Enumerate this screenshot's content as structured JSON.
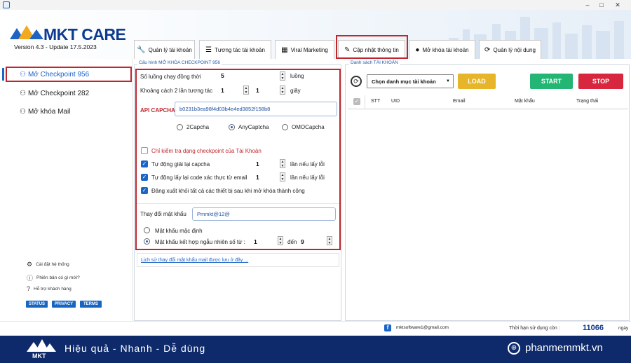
{
  "window": {
    "minimize": "‒",
    "maximize": "□",
    "close": "✕"
  },
  "header": {
    "brand": "MKT CARE",
    "version": "Version 4.3 - Update 17.5.2023"
  },
  "tabs": [
    {
      "label": "Quản lý tài khoản",
      "icon": "wrench-icon"
    },
    {
      "label": "Tương tác tài khoản",
      "icon": "list-icon"
    },
    {
      "label": "Viral Marketing",
      "icon": "calendar-icon"
    },
    {
      "label": "Cập nhật thông tin",
      "icon": "pencil-icon"
    },
    {
      "label": "Mở khóa tài khoản",
      "icon": "user-icon"
    },
    {
      "label": "Quản lý nội dung",
      "icon": "refresh-icon"
    }
  ],
  "sidebar": {
    "items": [
      {
        "label": "Mở Checkpoint 956"
      },
      {
        "label": "Mở Checkpoint 282"
      },
      {
        "label": "Mở khóa Mail"
      }
    ],
    "links": [
      {
        "label": "Cài đặt hệ thống",
        "icon": "gear-icon"
      },
      {
        "label": "Phiên bản có gì mới?",
        "icon": "info-icon"
      },
      {
        "label": "Hỗ trợ khách hàng",
        "icon": "help-icon"
      }
    ],
    "pills": [
      "STATUS",
      "PRIVACY",
      "TERMS"
    ]
  },
  "config": {
    "group_title": "Cấu hình MỞ KHÓA CHECKPOINT 956",
    "threads_label": "Số luồng chạy đồng thời",
    "threads_value": "5",
    "threads_unit": "luồng",
    "interval_label": "Khoảng cách 2 lần tương tác",
    "interval_from": "1",
    "interval_to": "1",
    "interval_unit": "giây",
    "api_label": "API CAPCHA",
    "api_value": "b0231b3ea98f4d03b4e4ed3852f158b8",
    "captcha_options": [
      "2Capcha",
      "AnyCaptcha",
      "OMOCapcha"
    ],
    "captcha_selected": 1,
    "check_type_label": "Chỉ kiểm tra dạng checkpoint của Tài Khoản",
    "auto_captcha_label": "Tự động giải lại capcha",
    "auto_captcha_value": "1",
    "auto_captcha_unit": "lần nếu lấy lỗi",
    "auto_email_label": "Tự động lấy lại code xác thực từ email",
    "auto_email_value": "1",
    "auto_email_unit": "lần nếu lấy lỗi",
    "logout_label": "Đăng xuất khỏi tất cả các thiết bị sau khi mở khóa thành công",
    "pw_label": "Thay đổi mật khẩu",
    "pw_value": "Pmmkt@12@",
    "pw_default_label": "Mật khẩu mặc định",
    "pw_random_label": "Mật khẩu kết hợp ngẫu nhiên số từ :",
    "pw_random_from": "1",
    "pw_random_to_label": "đến",
    "pw_random_to": "9",
    "history_link": "Lịch sử thay đổi mật khẩu mail được lưu ở đây ..."
  },
  "accounts": {
    "group_title": "Danh sách TÀI KHOẢN",
    "select_value": "Chọn danh mục tài khoản",
    "load": "LOAD",
    "start": "START",
    "stop": "STOP",
    "columns": [
      "STT",
      "UID",
      "Email",
      "Mật khẩu",
      "Trạng thái"
    ]
  },
  "status": {
    "email": "mktsoftware1@gmail.com",
    "remaining_label": "Thời hạn sử dụng còn :",
    "remaining_value": "11066",
    "remaining_unit": "ngày"
  },
  "footer": {
    "slogan": "Hiệu quả - Nhanh - Dễ dùng",
    "site": "phanmemmkt.vn",
    "logo_text": "MKT"
  },
  "colors": {
    "accent_red": "#c0262d",
    "brand_blue": "#0d3b8f",
    "load": "#e6b52a",
    "start": "#22b573",
    "stop": "#d7263d"
  }
}
